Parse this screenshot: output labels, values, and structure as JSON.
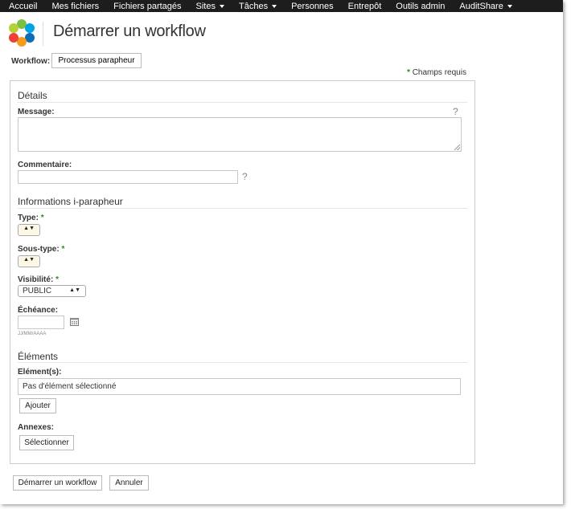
{
  "nav": {
    "items": [
      {
        "label": "Accueil",
        "dropdown": false
      },
      {
        "label": "Mes fichiers",
        "dropdown": false
      },
      {
        "label": "Fichiers partagés",
        "dropdown": false
      },
      {
        "label": "Sites",
        "dropdown": true
      },
      {
        "label": "Tâches",
        "dropdown": true
      },
      {
        "label": "Personnes",
        "dropdown": false
      },
      {
        "label": "Entrepôt",
        "dropdown": false
      },
      {
        "label": "Outils admin",
        "dropdown": false
      },
      {
        "label": "AuditShare",
        "dropdown": true
      }
    ],
    "background": "#1d1d1d"
  },
  "header": {
    "title": "Démarrer un workflow",
    "logo_icon": "alfresco-flower-logo"
  },
  "workflow": {
    "label": "Workflow:",
    "selected": "Processus parapheur"
  },
  "required_note": {
    "star": "*",
    "text": "Champs requis"
  },
  "form": {
    "details": {
      "title": "Détails",
      "message_label": "Message:",
      "message_value": "",
      "comment_label": "Commentaire:",
      "comment_value": "",
      "help": "?"
    },
    "parapheur": {
      "title": "Informations i-parapheur",
      "type_label": "Type:",
      "subtype_label": "Sous-type:",
      "visibility_label": "Visibilité:",
      "visibility_value": "PUBLIC",
      "deadline_label": "Échéance:",
      "deadline_value": "",
      "date_hint": "JJ/MM/AAAA",
      "required_star": "*",
      "select_arrows": "▲▼"
    },
    "elements": {
      "title": "Éléments",
      "elements_label": "Elément(s):",
      "elements_value": "Pas d'élément sélectionné",
      "add_button": "Ajouter",
      "annexes_label": "Annexes:",
      "select_button": "Sélectionner"
    }
  },
  "footer": {
    "start_button": "Démarrer un workflow",
    "cancel_button": "Annuler"
  },
  "colors": {
    "required_star": "#2a8a2a",
    "select_bg": "#fdf8e6"
  }
}
